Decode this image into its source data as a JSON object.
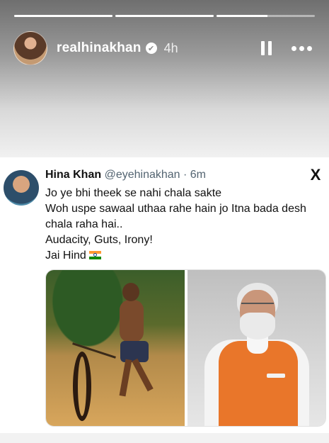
{
  "story": {
    "progress": [
      1.0,
      1.0,
      0.52
    ],
    "username": "realhinakhan",
    "time_ago": "4h",
    "verified_icon": "verified-check-icon",
    "pause_icon": "pause-icon",
    "more_icon": "more-horizontal-icon"
  },
  "tweet": {
    "name": "Hina Khan",
    "handle": "@eyehinakhan",
    "time": "6m",
    "separator": " · ",
    "platform_logo": "X",
    "lines": [
      "Jo ye bhi theek se nahi chala sakte",
      "Woh uspe sawaal uthaa rahe hain jo Itna bada desh",
      "chala raha hai..",
      "Audacity, Guts, Irony!",
      "Jai Hind"
    ],
    "flag_icon": "india-flag-icon"
  },
  "colors": {
    "handle_gray": "#536471",
    "vest_orange": "#e9762a"
  }
}
